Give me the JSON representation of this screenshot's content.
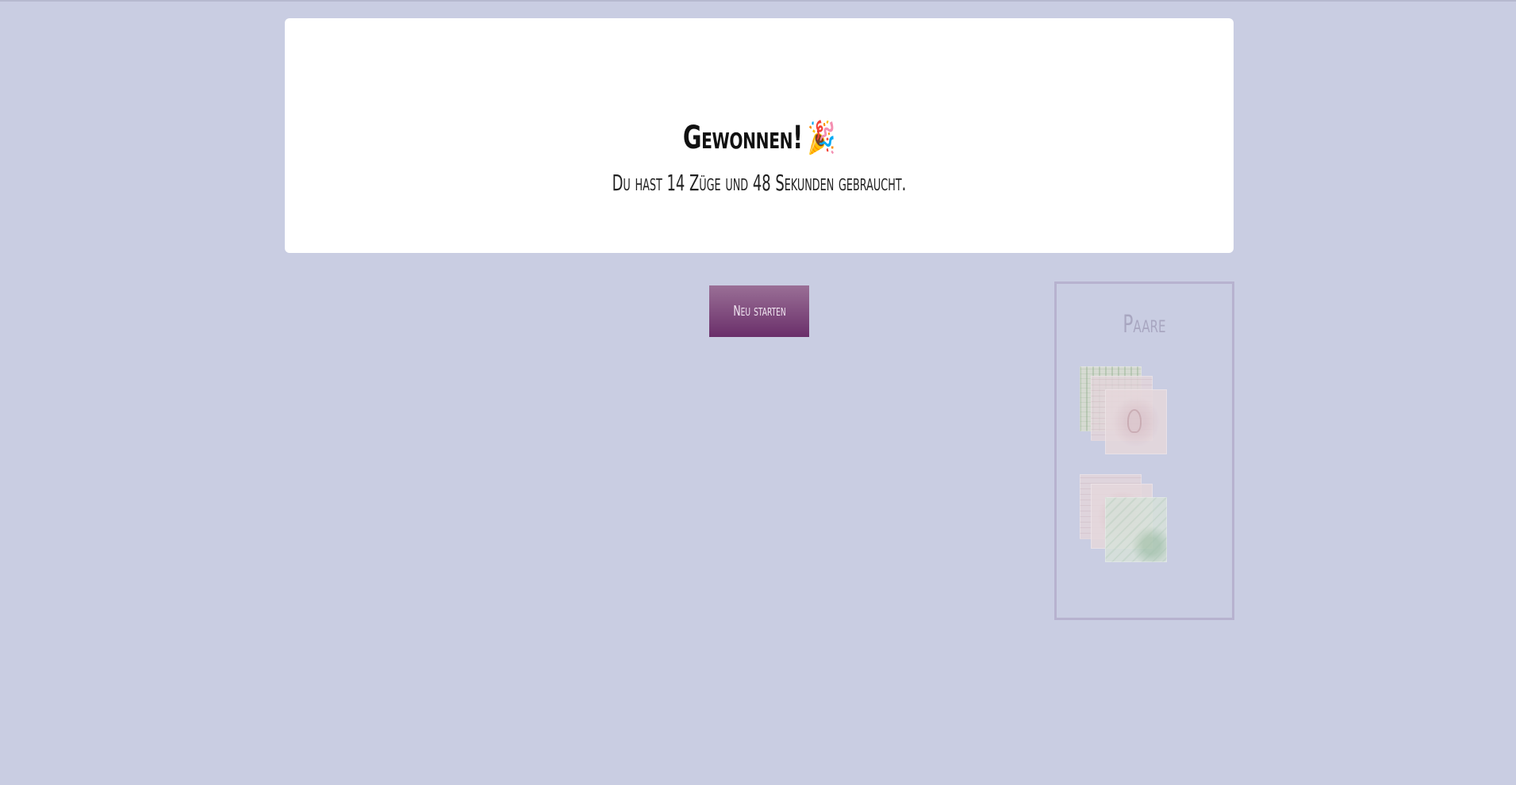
{
  "result": {
    "title": "Gewonnen!",
    "title_icon": "party-popper-icon",
    "title_icon_glyph": "🎉",
    "subtitle": "Du hast 14 Züge und 48 Sekunden gebraucht.",
    "moves": 14,
    "seconds": 48
  },
  "controls": {
    "restart_label": "Neu starten"
  },
  "pairs": {
    "title": "Paare",
    "stacks": [
      {
        "cards": [
          "green-certificate-card",
          "pink-document-card",
          "pink-portrait-card"
        ]
      },
      {
        "cards": [
          "pink-document-card",
          "pink-document-card",
          "green-stamp-document-card"
        ]
      }
    ]
  },
  "colors": {
    "background": "#c9cde2",
    "panel": "#ffffff",
    "button_top": "#9a6f96",
    "button_bottom": "#6a2f6a",
    "pairs_border": "#b7b2cf",
    "pairs_title": "#a8a6c0"
  }
}
